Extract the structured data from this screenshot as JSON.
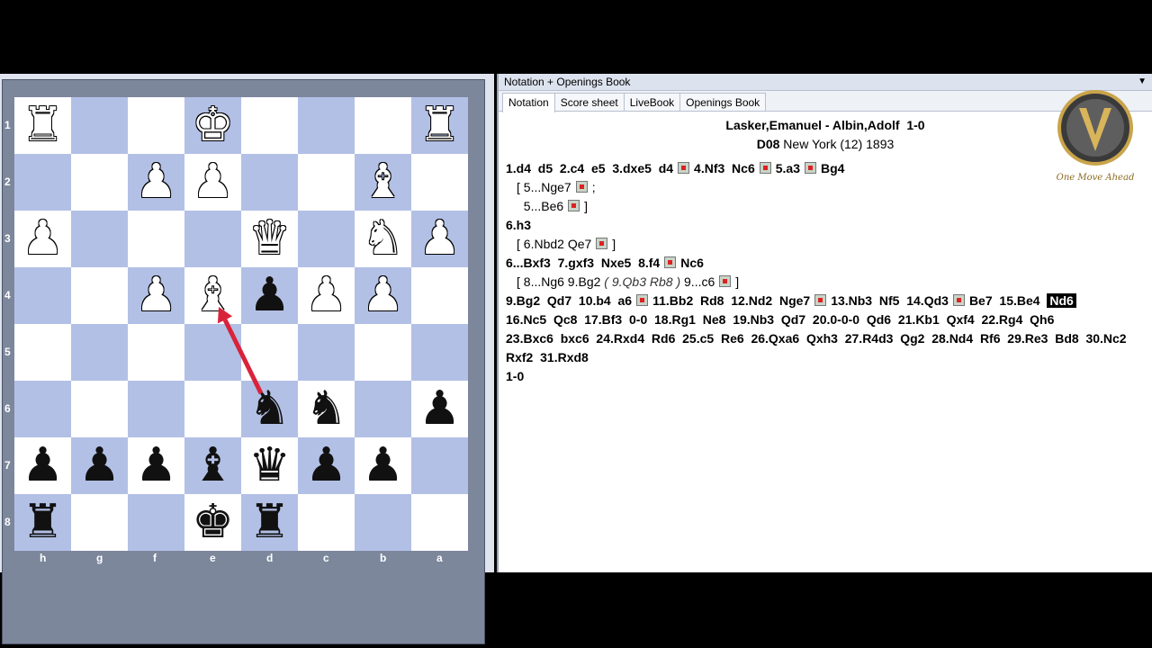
{
  "notation_panel": {
    "title": "Notation + Openings Book",
    "tabs": [
      "Notation",
      "Score sheet",
      "LiveBook",
      "Openings Book"
    ],
    "players": "Lasker,Emanuel - Albin,Adolf",
    "result": "1-0",
    "eco": "D08",
    "event": "New York (12) 1893",
    "logo_text": "One Move Ahead"
  },
  "moves": {
    "l1": [
      "1.d4",
      "d5",
      "2.c4",
      "e5",
      "3.dxe5",
      "d4",
      "4.Nf3",
      "Nc6",
      "5.a3",
      "Bg4"
    ],
    "v1": "[ 5...Nge7",
    "v1end": ";",
    "v2": "5...Be6",
    "v2end": "]",
    "l2": "6.h3",
    "v3": "[ 6.Nbd2  Qe7",
    "v3end": "]",
    "l3": [
      "6...Bxf3",
      "7.gxf3",
      "Nxe5",
      "8.f4",
      "Nc6"
    ],
    "v4a": "[ 8...Ng6  9.Bg2",
    "v4b": "( 9.Qb3  Rb8 )",
    "v4c": "9...c6",
    "v4end": "]",
    "l4": [
      "9.Bg2",
      "Qd7",
      "10.b4",
      "a6",
      "11.Bb2",
      "Rd8",
      "12.Nd2",
      "Nge7",
      "13.Nb3",
      "Nf5",
      "14.Qd3",
      "Be7",
      "15.Be4",
      "Nd6"
    ],
    "l5": [
      "16.Nc5",
      "Qc8",
      "17.Bf3",
      "0-0",
      "18.Rg1",
      "Ne8",
      "19.Nb3",
      "Qd7",
      "20.0-0-0",
      "Qd6",
      "21.Kb1",
      "Qxf4",
      "22.Rg4",
      "Qh6"
    ],
    "l6": [
      "23.Bxc6",
      "bxc6",
      "24.Rxd4",
      "Rd6",
      "25.c5",
      "Re6",
      "26.Qxa6",
      "Qxh3",
      "27.R4d3",
      "Qg2",
      "28.Nd4",
      "Rf6",
      "29.Re3",
      "Bd8",
      "30.Nc2"
    ],
    "l7": [
      "Rxf2",
      "31.Rxd8"
    ],
    "final": "1-0"
  },
  "board": {
    "ranks": [
      "1",
      "2",
      "3",
      "4",
      "5",
      "6",
      "7",
      "8"
    ],
    "files": [
      "h",
      "g",
      "f",
      "e",
      "d",
      "c",
      "b",
      "a"
    ],
    "pieces": [
      {
        "sq": "h1",
        "p": "♜",
        "c": "w"
      },
      {
        "sq": "e1",
        "p": "♚",
        "c": "w"
      },
      {
        "sq": "a1",
        "p": "♜",
        "c": "w"
      },
      {
        "sq": "f2",
        "p": "♟",
        "c": "w"
      },
      {
        "sq": "e2",
        "p": "♟",
        "c": "w"
      },
      {
        "sq": "b2",
        "p": "♝",
        "c": "w"
      },
      {
        "sq": "h3",
        "p": "♟",
        "c": "w"
      },
      {
        "sq": "d3",
        "p": "♛",
        "c": "w"
      },
      {
        "sq": "b3",
        "p": "♞",
        "c": "w"
      },
      {
        "sq": "a3",
        "p": "♟",
        "c": "w"
      },
      {
        "sq": "f4",
        "p": "♟",
        "c": "w"
      },
      {
        "sq": "e4",
        "p": "♝",
        "c": "w"
      },
      {
        "sq": "d4",
        "p": "♟",
        "c": "b"
      },
      {
        "sq": "c4",
        "p": "♟",
        "c": "w"
      },
      {
        "sq": "b4",
        "p": "♟",
        "c": "w"
      },
      {
        "sq": "d6",
        "p": "♞",
        "c": "b"
      },
      {
        "sq": "c6",
        "p": "♞",
        "c": "b"
      },
      {
        "sq": "a6",
        "p": "♟",
        "c": "b"
      },
      {
        "sq": "h7",
        "p": "♟",
        "c": "b"
      },
      {
        "sq": "g7",
        "p": "♟",
        "c": "b"
      },
      {
        "sq": "f7",
        "p": "♟",
        "c": "b"
      },
      {
        "sq": "e7",
        "p": "♝",
        "c": "b"
      },
      {
        "sq": "d7",
        "p": "♛",
        "c": "b"
      },
      {
        "sq": "c7",
        "p": "♟",
        "c": "b"
      },
      {
        "sq": "b7",
        "p": "♟",
        "c": "b"
      },
      {
        "sq": "h8",
        "p": "♜",
        "c": "b"
      },
      {
        "sq": "e8",
        "p": "♚",
        "c": "b"
      },
      {
        "sq": "d8",
        "p": "♜",
        "c": "b"
      }
    ],
    "arrow": {
      "from": "d6",
      "to": "e4",
      "color": "#d9233a"
    }
  }
}
